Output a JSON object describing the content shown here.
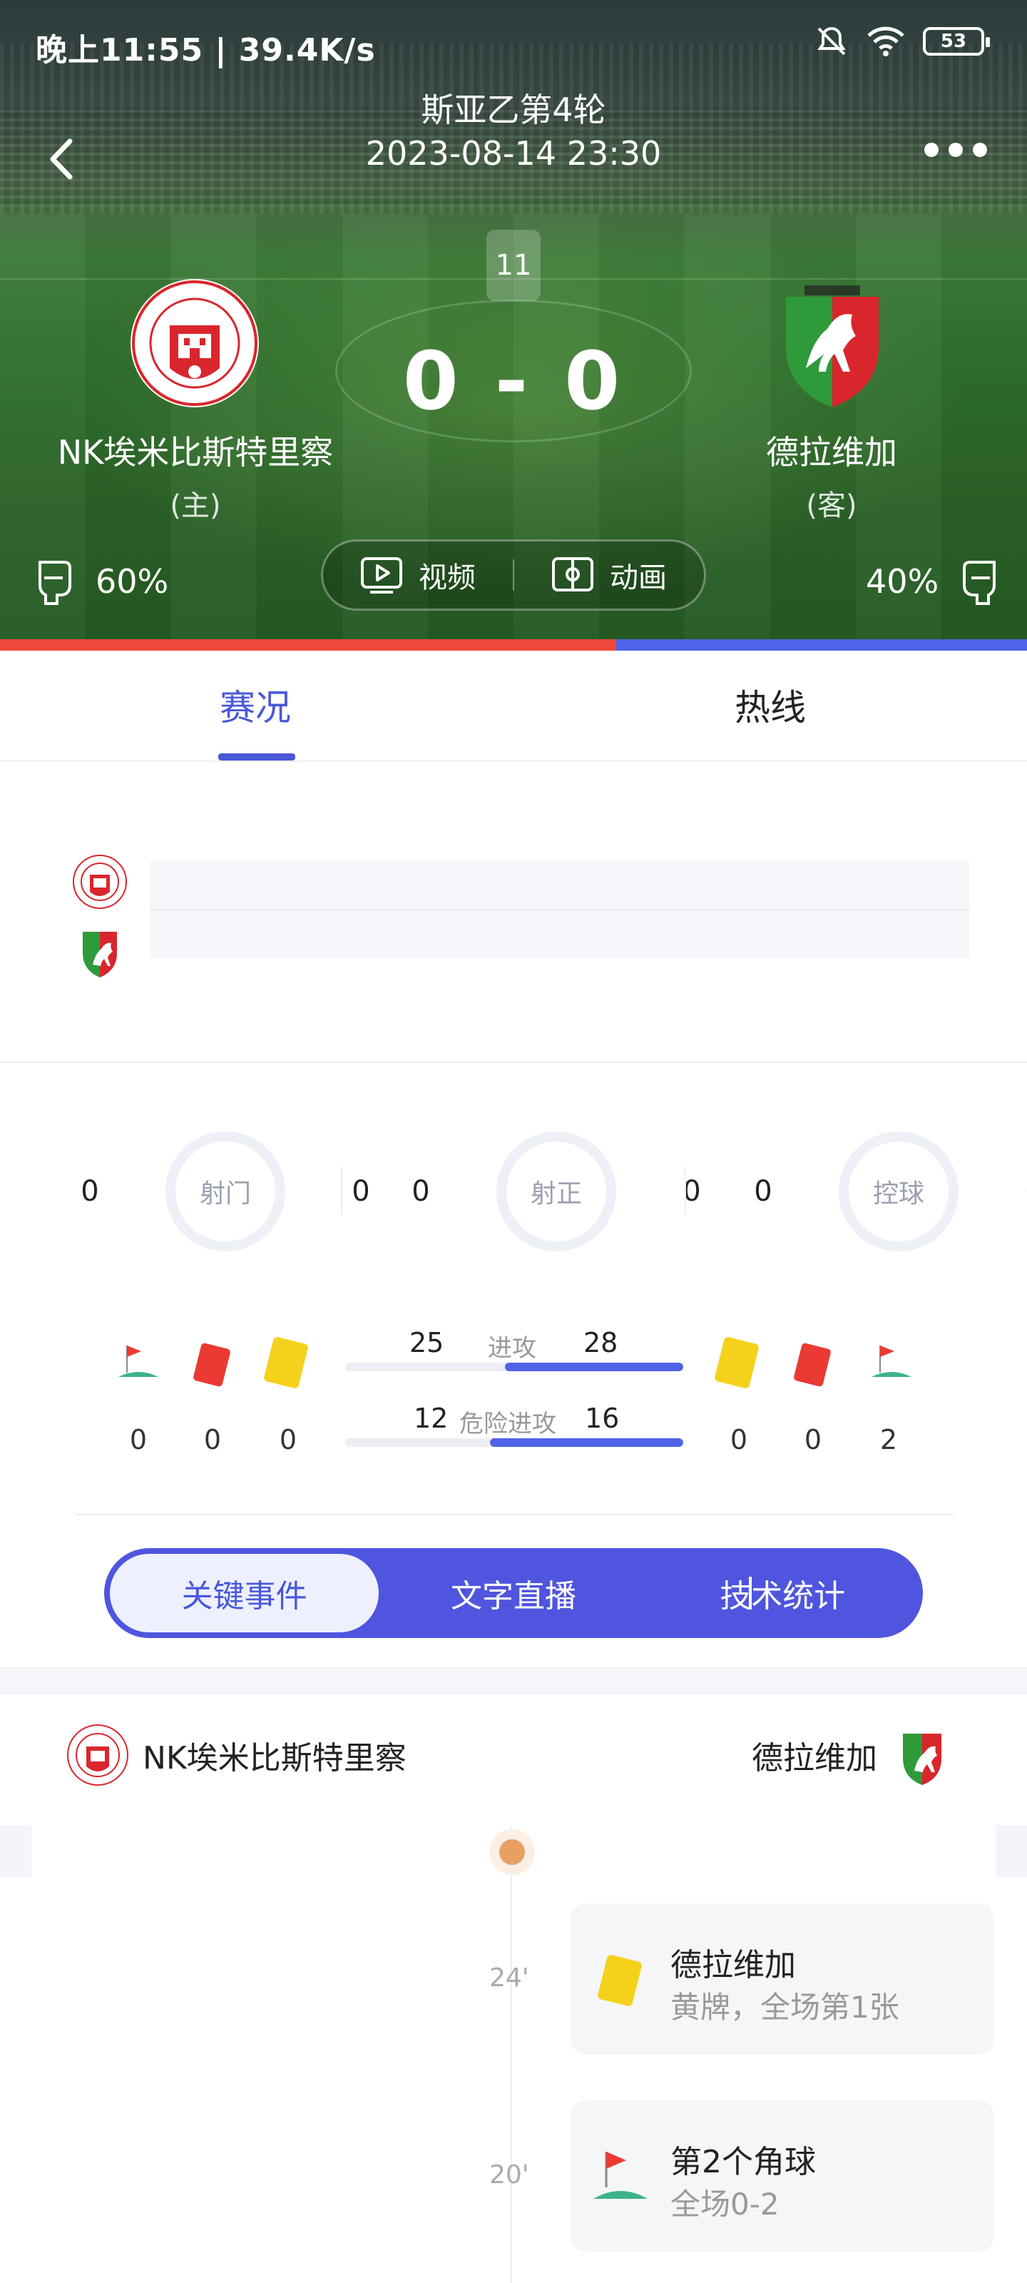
{
  "status_bar": {
    "time_speed": "晚上11:55 | 39.4K/s",
    "battery": "53"
  },
  "header": {
    "round": "斯亚乙第4轮",
    "datetime": "2023-08-14 23:30",
    "minute": "11"
  },
  "score": "0 - 0",
  "home": {
    "name": "NK埃米比斯特里察",
    "tag": "(主)",
    "possession": "60%",
    "possession_value": 0.6
  },
  "away": {
    "name": "德拉维加",
    "tag": "(客)",
    "possession": "40%",
    "possession_value": 0.4
  },
  "media": {
    "video": "视频",
    "animation": "动画"
  },
  "tabs": {
    "live": "赛况",
    "hotline": "热线"
  },
  "stats_circles": [
    {
      "label": "射门",
      "home": "0",
      "away": "0"
    },
    {
      "label": "射正",
      "home": "0",
      "away": "0"
    },
    {
      "label": "控球",
      "home": "0",
      "away": "0"
    }
  ],
  "cards": {
    "home": {
      "corners": "0",
      "red": "0",
      "yellow": "0"
    },
    "away": {
      "yellow": "0",
      "red": "0",
      "corners": "2"
    }
  },
  "bars": [
    {
      "label": "进攻",
      "home": "25",
      "away": "28",
      "home_value": 25,
      "away_value": 28
    },
    {
      "label": "危险进攻",
      "home": "12",
      "away": "16",
      "home_value": 12,
      "away_value": 16
    }
  ],
  "segment": {
    "key_events": "关键事件",
    "text_live": "文字直播",
    "tech_stats": "技术统计"
  },
  "events_header": {
    "home": "NK埃米比斯特里察",
    "away": "德拉维加"
  },
  "events": [
    {
      "minute": "24'",
      "team": "德拉维加",
      "desc": "黄牌，全场第1张",
      "type": "yellow-card"
    },
    {
      "minute": "20'",
      "team": "第2个角球",
      "desc": "全场0-2",
      "type": "corner"
    }
  ],
  "colors": {
    "home_bar": "#f0493e",
    "away_bar": "#4f63e6",
    "accent": "#4a58d9"
  }
}
